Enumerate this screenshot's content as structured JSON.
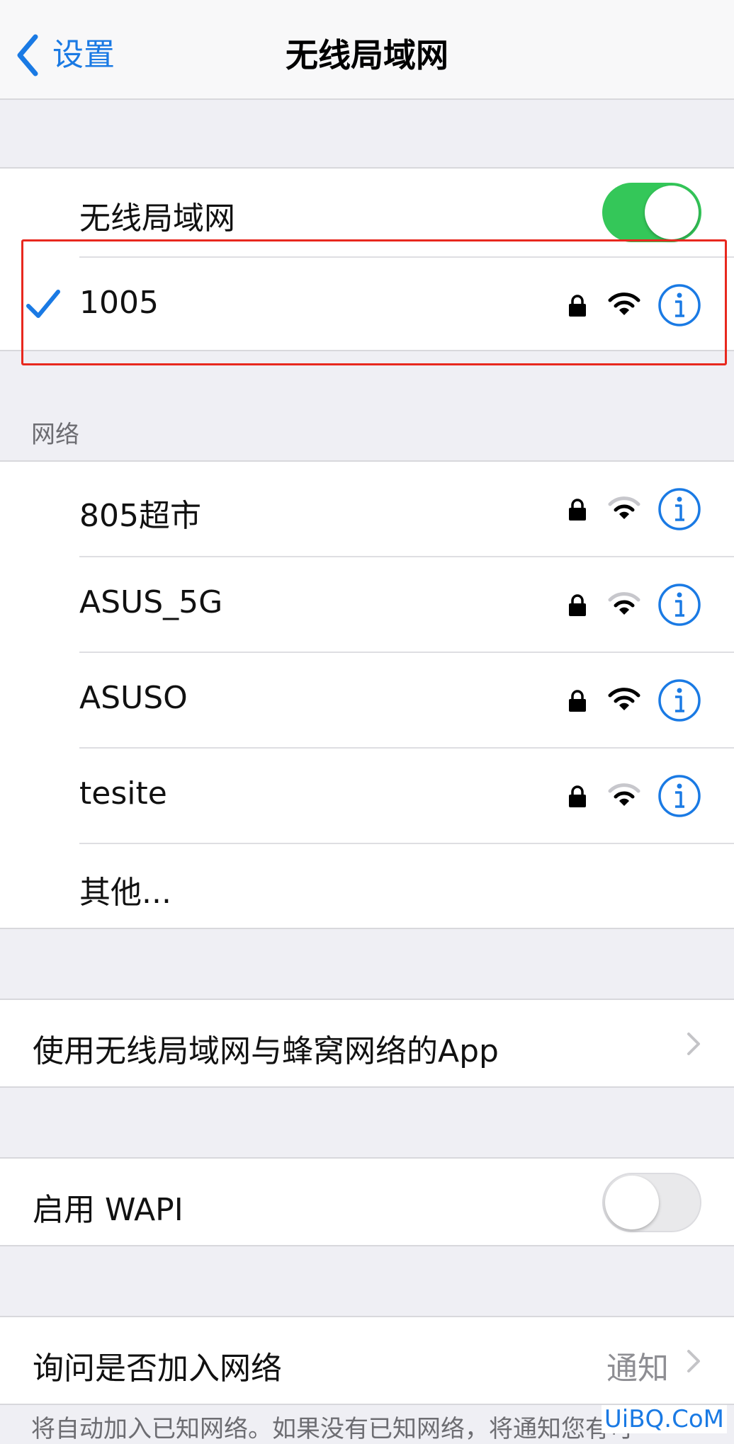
{
  "nav": {
    "back_label": "设置",
    "title": "无线局域网"
  },
  "wifi_toggle": {
    "label": "无线局域网",
    "state": "on"
  },
  "connected_network": {
    "name": "1005",
    "secured": true,
    "signal": "full"
  },
  "networks_header": "网络",
  "networks": [
    {
      "name": "805超市",
      "secured": true,
      "signal": "medium"
    },
    {
      "name": "ASUS_5G",
      "secured": true,
      "signal": "medium"
    },
    {
      "name": "ASUSO",
      "secured": true,
      "signal": "full"
    },
    {
      "name": "tesite",
      "secured": true,
      "signal": "medium"
    }
  ],
  "other_label": "其他...",
  "apps_row": {
    "label": "使用无线局域网与蜂窝网络的App"
  },
  "wapi_row": {
    "label": "启用 WAPI",
    "state": "off"
  },
  "ask_join_row": {
    "label": "询问是否加入网络",
    "value": "通知"
  },
  "footer_text": "将自动加入已知网络。如果没有已知网络，将通知您有可",
  "watermark": "UiBQ.CoM",
  "colors": {
    "accent": "#1a7ae4",
    "switch_on": "#34c759",
    "highlight": "#e8281e"
  }
}
